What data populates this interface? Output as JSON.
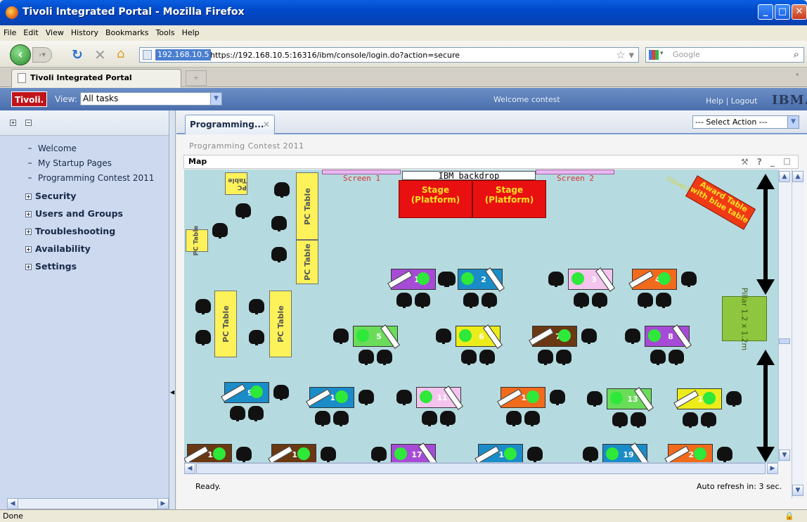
{
  "window": {
    "title": "Tivoli Integrated Portal - Mozilla Firefox"
  },
  "menu": [
    "File",
    "Edit",
    "View",
    "History",
    "Bookmarks",
    "Tools",
    "Help"
  ],
  "navbar": {
    "host_badge": "192.168.10.5",
    "url": "https://192.168.10.5:16316/ibm/console/login.do?action=secure",
    "search_placeholder": "Google"
  },
  "browser_tab": {
    "label": "Tivoli Integrated Portal"
  },
  "tivoli": {
    "logo": "Tivoli.",
    "view_label": "View:",
    "view_value": "All tasks",
    "welcome": "Welcome contest",
    "help": "Help",
    "sep": "|",
    "logout": "Logout",
    "ibm": "IBM."
  },
  "sidebar": {
    "items": [
      "Welcome",
      "My Startup Pages",
      "Programming Contest 2011"
    ],
    "folders": [
      "Security",
      "Users and Groups",
      "Troubleshooting",
      "Availability",
      "Settings"
    ]
  },
  "content": {
    "tab_label": "Programming...",
    "action_select": "--- Select Action ---",
    "breadcrumb": "Programming Contest 2011",
    "portlet_title": "Map",
    "portlet_icons": "⚒ ? _ ☐"
  },
  "map": {
    "screen1": "Screen 1",
    "screen2": "Screen 2",
    "backdrop": "IBM backdrop",
    "stage_label": "Stage (Platform)",
    "pc_table": "PC Table",
    "pillar": "Pillar 1.2 x 1.2m",
    "award": "Award Table with blue table",
    "cover": "(cover)",
    "teams": [
      {
        "n": "1",
        "color": "#a64bd6"
      },
      {
        "n": "2",
        "color": "#1a8cc8"
      },
      {
        "n": "3",
        "color": "#f4c4ee"
      },
      {
        "n": "4",
        "color": "#f26a1c"
      },
      {
        "n": "5",
        "color": "#6adc5a"
      },
      {
        "n": "6",
        "color": "#ecec1a"
      },
      {
        "n": "7",
        "color": "#6a3812"
      },
      {
        "n": "8",
        "color": "#a64bd6"
      },
      {
        "n": "9",
        "color": "#1a8cc8"
      },
      {
        "n": "10",
        "color": "#1a8cc8"
      },
      {
        "n": "11",
        "color": "#f4c4ee"
      },
      {
        "n": "12",
        "color": "#f26a1c"
      },
      {
        "n": "13",
        "color": "#6adc5a"
      },
      {
        "n": "14",
        "color": "#ecec1a"
      },
      {
        "n": "15",
        "color": "#6a3812"
      },
      {
        "n": "16",
        "color": "#6a3812"
      },
      {
        "n": "17",
        "color": "#a64bd6"
      },
      {
        "n": "18",
        "color": "#1a8cc8"
      },
      {
        "n": "19",
        "color": "#1a8cc8"
      },
      {
        "n": "20",
        "color": "#f26a1c"
      }
    ]
  },
  "status": {
    "ready": "Ready.",
    "auto_refresh": "Auto refresh in: 3 sec.",
    "browser": "Done"
  }
}
